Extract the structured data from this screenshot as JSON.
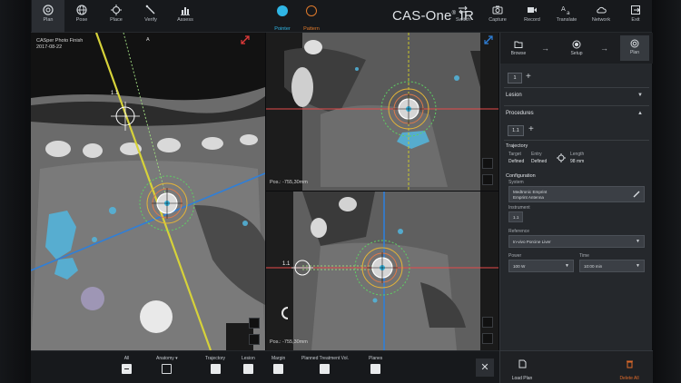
{
  "toolbar": {
    "left_buttons": [
      {
        "label": "Plan",
        "icon": "target-icon",
        "active": true
      },
      {
        "label": "Pose",
        "icon": "globe-icon"
      },
      {
        "label": "Place",
        "icon": "crosshair-icon"
      },
      {
        "label": "Verify",
        "icon": "needle-icon"
      },
      {
        "label": "Assess",
        "icon": "bar-chart-icon"
      }
    ],
    "modes": [
      {
        "label": "Pointer",
        "color": "#2fb6e6"
      },
      {
        "label": "Pattern",
        "color": "#e07a2c"
      }
    ],
    "brand": "CAS-One",
    "brand_suffix": "IR",
    "brand_sup": "®",
    "right_buttons": [
      {
        "label": "Switch",
        "icon": "swap-icon"
      },
      {
        "label": "Capture",
        "icon": "camera-icon"
      },
      {
        "label": "Record",
        "icon": "video-icon"
      },
      {
        "label": "Translate",
        "icon": "translate-icon"
      },
      {
        "label": "Network",
        "icon": "cloud-icon"
      },
      {
        "label": "Exit",
        "icon": "exit-icon"
      }
    ]
  },
  "viewports": {
    "main": {
      "patient": "CASper Photo Finish",
      "date": "2017-08-22",
      "orientation": "A",
      "needle_label": "1.1"
    },
    "top_right": {
      "pos": "Pos.: -755,30mm"
    },
    "bottom_right": {
      "pos": "Pos.: -755,30mm",
      "needle_label": "1.1"
    }
  },
  "panel": {
    "steps": [
      {
        "label": "Browse",
        "icon": "folder-icon"
      },
      {
        "label": "Setup",
        "icon": "record-icon"
      },
      {
        "label": "Plan",
        "icon": "target-icon",
        "active": true
      }
    ],
    "lesion_tab": "1",
    "lesion_header": "Lesion",
    "procedures_header": "Procedures",
    "procedure_tab": "1.1",
    "trajectory": {
      "title": "Trajectory",
      "target_label": "Target",
      "target_value": "Defined",
      "entry_label": "Entry",
      "entry_value": "Defined",
      "length_label": "Length",
      "length_value": "98 mm"
    },
    "configuration": {
      "title": "Configuration",
      "system_label": "System",
      "system_line1": "Medtronic Emprint",
      "system_line2": "Emprint Antenna",
      "instrument_label": "Instrument",
      "instrument_value": "1.1",
      "reference_label": "Reference",
      "reference_value": "In-vivo Porcine Liver",
      "power_label": "Power",
      "power_value": "100 W",
      "time_label": "Time",
      "time_value": "10:00 min"
    },
    "bottom": {
      "load_label": "Load Plan",
      "delete_label": "Delete All",
      "delete_color": "#e06a2a"
    }
  },
  "bottombar": {
    "items": [
      {
        "label": "All",
        "state": "partial"
      },
      {
        "label": "Anatomy",
        "state": "off",
        "dropdown": true
      },
      {
        "label": "Trajectory",
        "state": "on"
      },
      {
        "label": "Lesion",
        "state": "on"
      },
      {
        "label": "Margin",
        "state": "on"
      },
      {
        "label": "Planned Treatment Vol.",
        "state": "on"
      },
      {
        "label": "Planes",
        "state": "on"
      }
    ]
  }
}
